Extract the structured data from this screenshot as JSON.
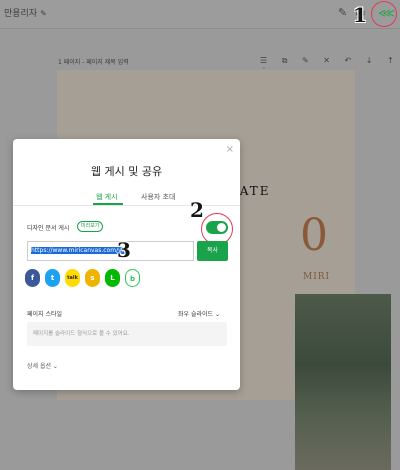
{
  "topbar": {
    "doc_name": "만용리자",
    "pencil_icon": "pencil-icon",
    "edit_icon": "edit-icon",
    "preview_icon": "device-icon",
    "share_icon": "share-icon",
    "share_ring_color": "#e03a55"
  },
  "steps": [
    "1",
    "2",
    "3"
  ],
  "page": {
    "label": "1 페이지 - 페이지 제목 입력",
    "tool_icons": "☰ ⧉ ✎ ✕ ↶ ↓ ↑ ⋮",
    "save_the_date": "SAVE THE DATE",
    "big_digit": "0",
    "name_line": "MIRI"
  },
  "modal": {
    "title": "웹 게시 및 공유",
    "close": "×",
    "tabs": [
      {
        "label": "웹 게시",
        "active": true
      },
      {
        "label": "사용자 초대",
        "active": false
      }
    ],
    "publish_label": "디자인 문서 게시",
    "badge": "미리보기",
    "toggle_on": true,
    "url": "https://www.miricanvas.com/v/1",
    "copy_label": "복사",
    "socials": [
      {
        "name": "facebook-icon",
        "glyph": "f",
        "color": "#3b5998"
      },
      {
        "name": "twitter-icon",
        "glyph": "t",
        "color": "#1da1f2"
      },
      {
        "name": "kakaotalk-icon",
        "glyph": "talk",
        "color": "#ffdc00"
      },
      {
        "name": "kakaostory-icon",
        "glyph": "s",
        "color": "#f0b400"
      },
      {
        "name": "line-icon",
        "glyph": "L",
        "color": "#00b900"
      },
      {
        "name": "band-icon",
        "glyph": "b",
        "color": "#2fc65a"
      }
    ],
    "style_label": "페이지 스타일",
    "style_value": "좌우 슬라이드",
    "style_desc": "페이지를 슬라이드 형식으로 볼 수 있어요.",
    "more_options": "상세 옵션"
  }
}
